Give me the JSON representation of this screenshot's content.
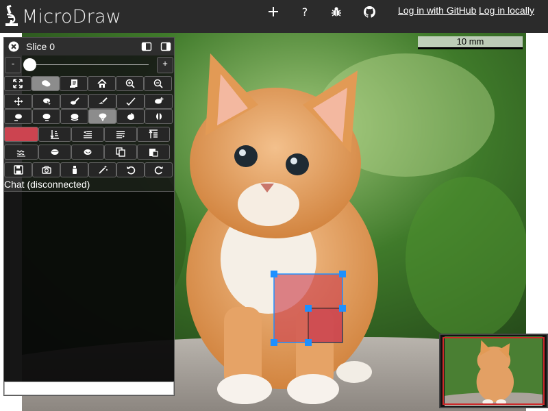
{
  "app": {
    "title": "MicroDraw"
  },
  "topbar": {
    "add_icon": "plus-icon",
    "help_icon": "question-icon",
    "bug_icon": "bug-icon",
    "github_icon": "github-icon",
    "login_github": "Log in with GitHub",
    "login_local": "Log in locally"
  },
  "panel": {
    "title": "Slice 0",
    "slider": {
      "minus": "-",
      "plus": "+",
      "value": 0
    },
    "selected_color": "#cc4450",
    "chat_title": "Chat (disconnected)",
    "chat_input_value": ""
  },
  "scalebar": {
    "label": "10 mm"
  },
  "colors": {
    "topbar": "#2b2b2b",
    "annotation": "#cc4450",
    "handle": "#1e90ff",
    "navigator_frame": "#cc2a2a"
  }
}
